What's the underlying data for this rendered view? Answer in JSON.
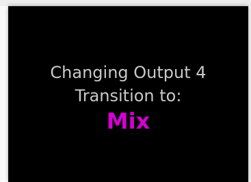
{
  "dialog": {
    "line1": "Changing Output 4",
    "line2": "Transition to:",
    "value": "Mix",
    "colors": {
      "background": "#000000",
      "text": "#c9c9c9",
      "value": "#d400d4"
    }
  }
}
